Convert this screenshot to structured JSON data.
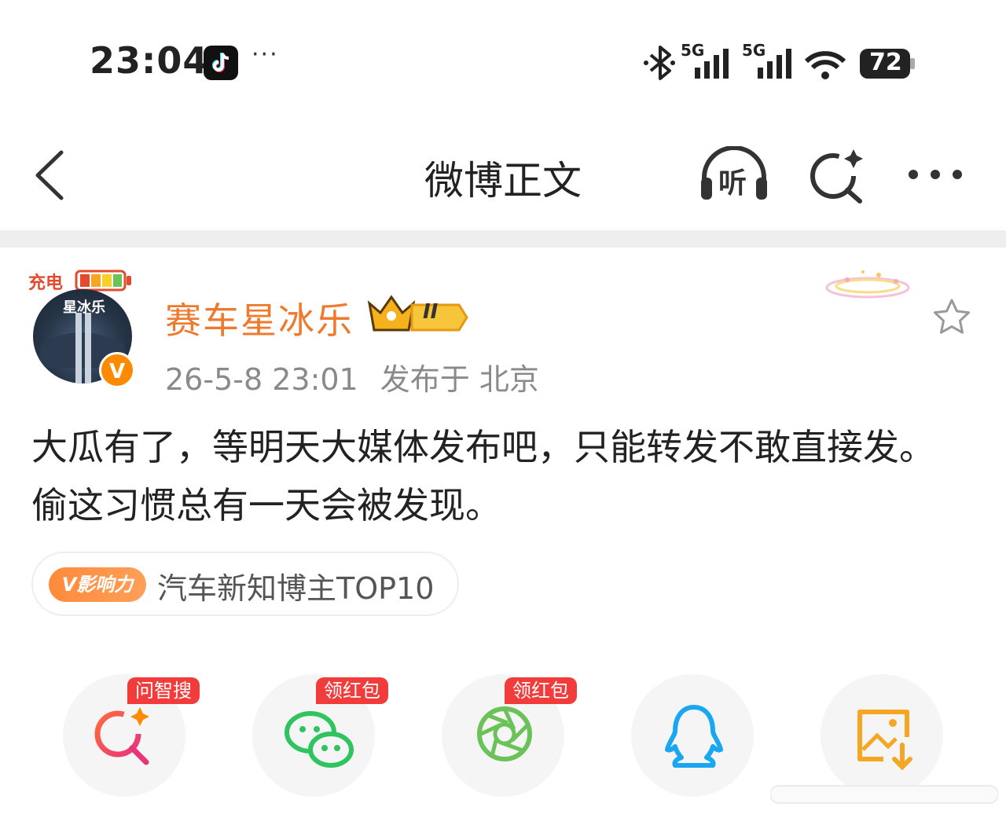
{
  "status_bar": {
    "time": "23:04",
    "overflow": "···",
    "network_1": "5G",
    "network_2": "5G",
    "battery": "72"
  },
  "nav": {
    "title": "微博正文",
    "listen_label": "听"
  },
  "author": {
    "charge_label": "充电",
    "avatar_text": "星冰乐",
    "name": "赛车星冰乐",
    "rank": "II",
    "verified_mark": "V",
    "timestamp": "26-5-8 23:01",
    "location": "发布于 北京"
  },
  "post": {
    "text_line_1": "大瓜有了，等明天大媒体发布吧，只能转发不敢直接发。",
    "text_line_2": "偷这习惯总有一天会被发现。"
  },
  "tag": {
    "badge": "V影响力",
    "text": "汽车新知博主TOP10"
  },
  "share": [
    {
      "name": "ai-search",
      "tag": "问智搜"
    },
    {
      "name": "wechat",
      "tag": "领红包"
    },
    {
      "name": "moments",
      "tag": "领红包"
    },
    {
      "name": "qq",
      "tag": ""
    },
    {
      "name": "save-image",
      "tag": ""
    }
  ],
  "colors": {
    "accent": "#ee7a2d",
    "red_tag": "#f23b3b",
    "wechat": "#2fc45f",
    "qq": "#1aa7f2",
    "save": "#f5a623"
  }
}
